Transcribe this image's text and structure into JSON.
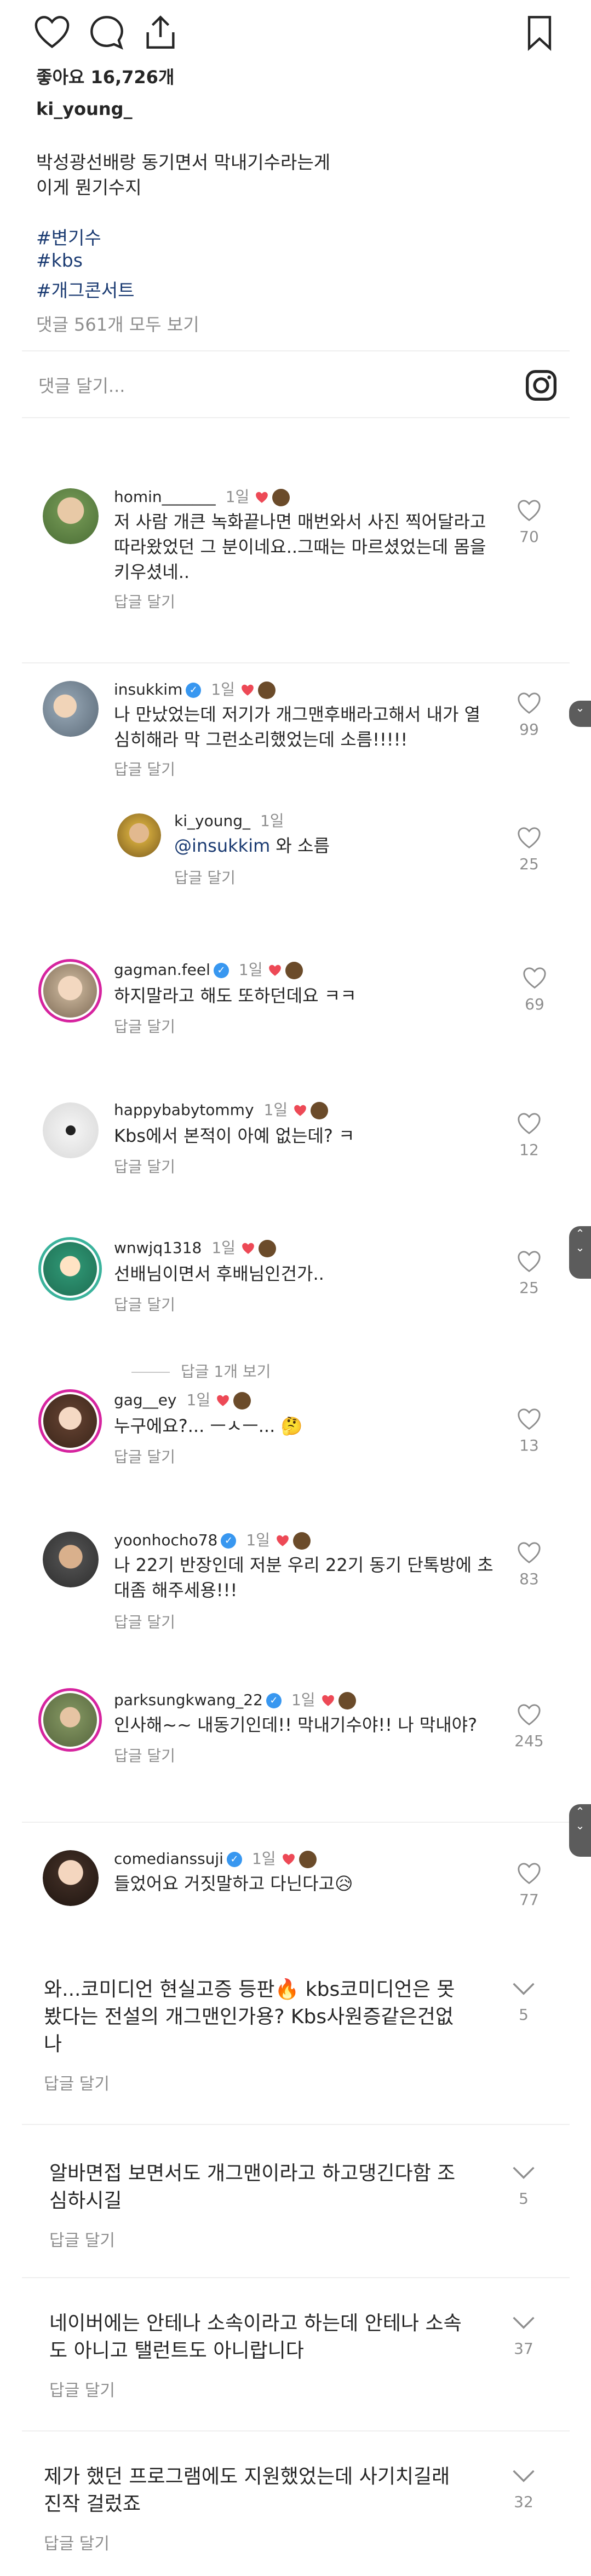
{
  "post": {
    "likes": "좋아요 16,726개",
    "username": "ki_young_",
    "caption": [
      "박성광선배랑 동기면서 막내기수라는게",
      "이게 뭔기수지"
    ],
    "hashtags": [
      "#변기수",
      "#kbs",
      "#개그콘서트"
    ],
    "view_all": "댓글 561개 모두 보기",
    "comment_placeholder": "댓글 달기..."
  },
  "icons": {
    "like": "heart-icon",
    "comment": "comment-icon",
    "share": "share-icon",
    "save": "bookmark-icon",
    "instagram": "instagram-icon"
  },
  "colors": {
    "heart": "#ed4956",
    "link": "#1b3b72",
    "muted": "#8e8e8e",
    "verified": "#3897f0"
  },
  "reply_label": "답글 달기",
  "view_replies": "답글 1개 보기",
  "comments": [
    {
      "user": "homin_______",
      "ago": "1일",
      "lines": [
        "저 사람 개큰 녹화끝나면 매번와서 사진 찍어달라고",
        "따라왔었던 그 분이네요..그때는 마르셨었는데 몸을",
        "키우셨네.."
      ],
      "likes": "70"
    },
    {
      "user": "insukkim",
      "ago": "1일",
      "lines": [
        "나 만났었는데 저기가 개그맨후배라고해서 내가 열",
        "심히해라 막 그런소리했었는데 소름!!!!!"
      ],
      "likes": "99"
    },
    {
      "user": "ki_young_",
      "ago": "1일",
      "mention": "@insukkim",
      "text": " 와 소름",
      "likes": "25"
    },
    {
      "user": "gagman.feel",
      "ago": "1일",
      "lines": [
        "하지말라고 해도 또하던데요 ㅋㅋ"
      ],
      "likes": "69"
    },
    {
      "user": "happybabytommy",
      "ago": "1일",
      "lines": [
        "Kbs에서 본적이 아예 없는데? ㅋ"
      ],
      "likes": "12"
    },
    {
      "user": "wnwjq1318",
      "ago": "1일",
      "lines": [
        "선배님이면서 후배님인건가.."
      ],
      "likes": "25"
    },
    {
      "user": "gag__ey",
      "ago": "1일",
      "lines": [
        "누구에요?... ㅡㅅㅡ... 🤔"
      ],
      "likes": "13"
    },
    {
      "user": "yoonhocho78",
      "ago": "1일",
      "lines": [
        "나 22기 반장인데 저분 우리 22기 동기 단톡방에 초",
        "대좀 해주세용!!!"
      ],
      "likes": "83"
    },
    {
      "user": "parksungkwang_22",
      "ago": "1일",
      "lines": [
        "인사해~~ 내동기인데!! 막내기수야!! 나 막내야?"
      ],
      "likes": "245"
    },
    {
      "user": "comedianssuji",
      "ago": "1일",
      "lines": [
        "들었어요 거짓말하고 다닌다고😥"
      ],
      "likes": "77"
    }
  ],
  "lower_comments": [
    {
      "lines": [
        "와...코미디언 현실고증 등판🔥 kbs코미디언은 못",
        "봤다는 전설의 개그맨인가용? Kbs사원증같은건없",
        "나"
      ],
      "likes": "5"
    },
    {
      "lines": [
        "알바면접 보면서도 개그맨이라고 하고댕긴다함 조",
        "심하시길"
      ],
      "likes": "5"
    },
    {
      "lines": [
        "네이버에는 안테나 소속이라고 하는데 안테나 소속",
        "도 아니고 탤런트도 아니랍니다"
      ],
      "likes": "37"
    },
    {
      "lines": [
        "제가 했던 프로그램에도 지원했었는데 사기치길래",
        "진작 걸렀죠"
      ],
      "likes": "32"
    }
  ]
}
